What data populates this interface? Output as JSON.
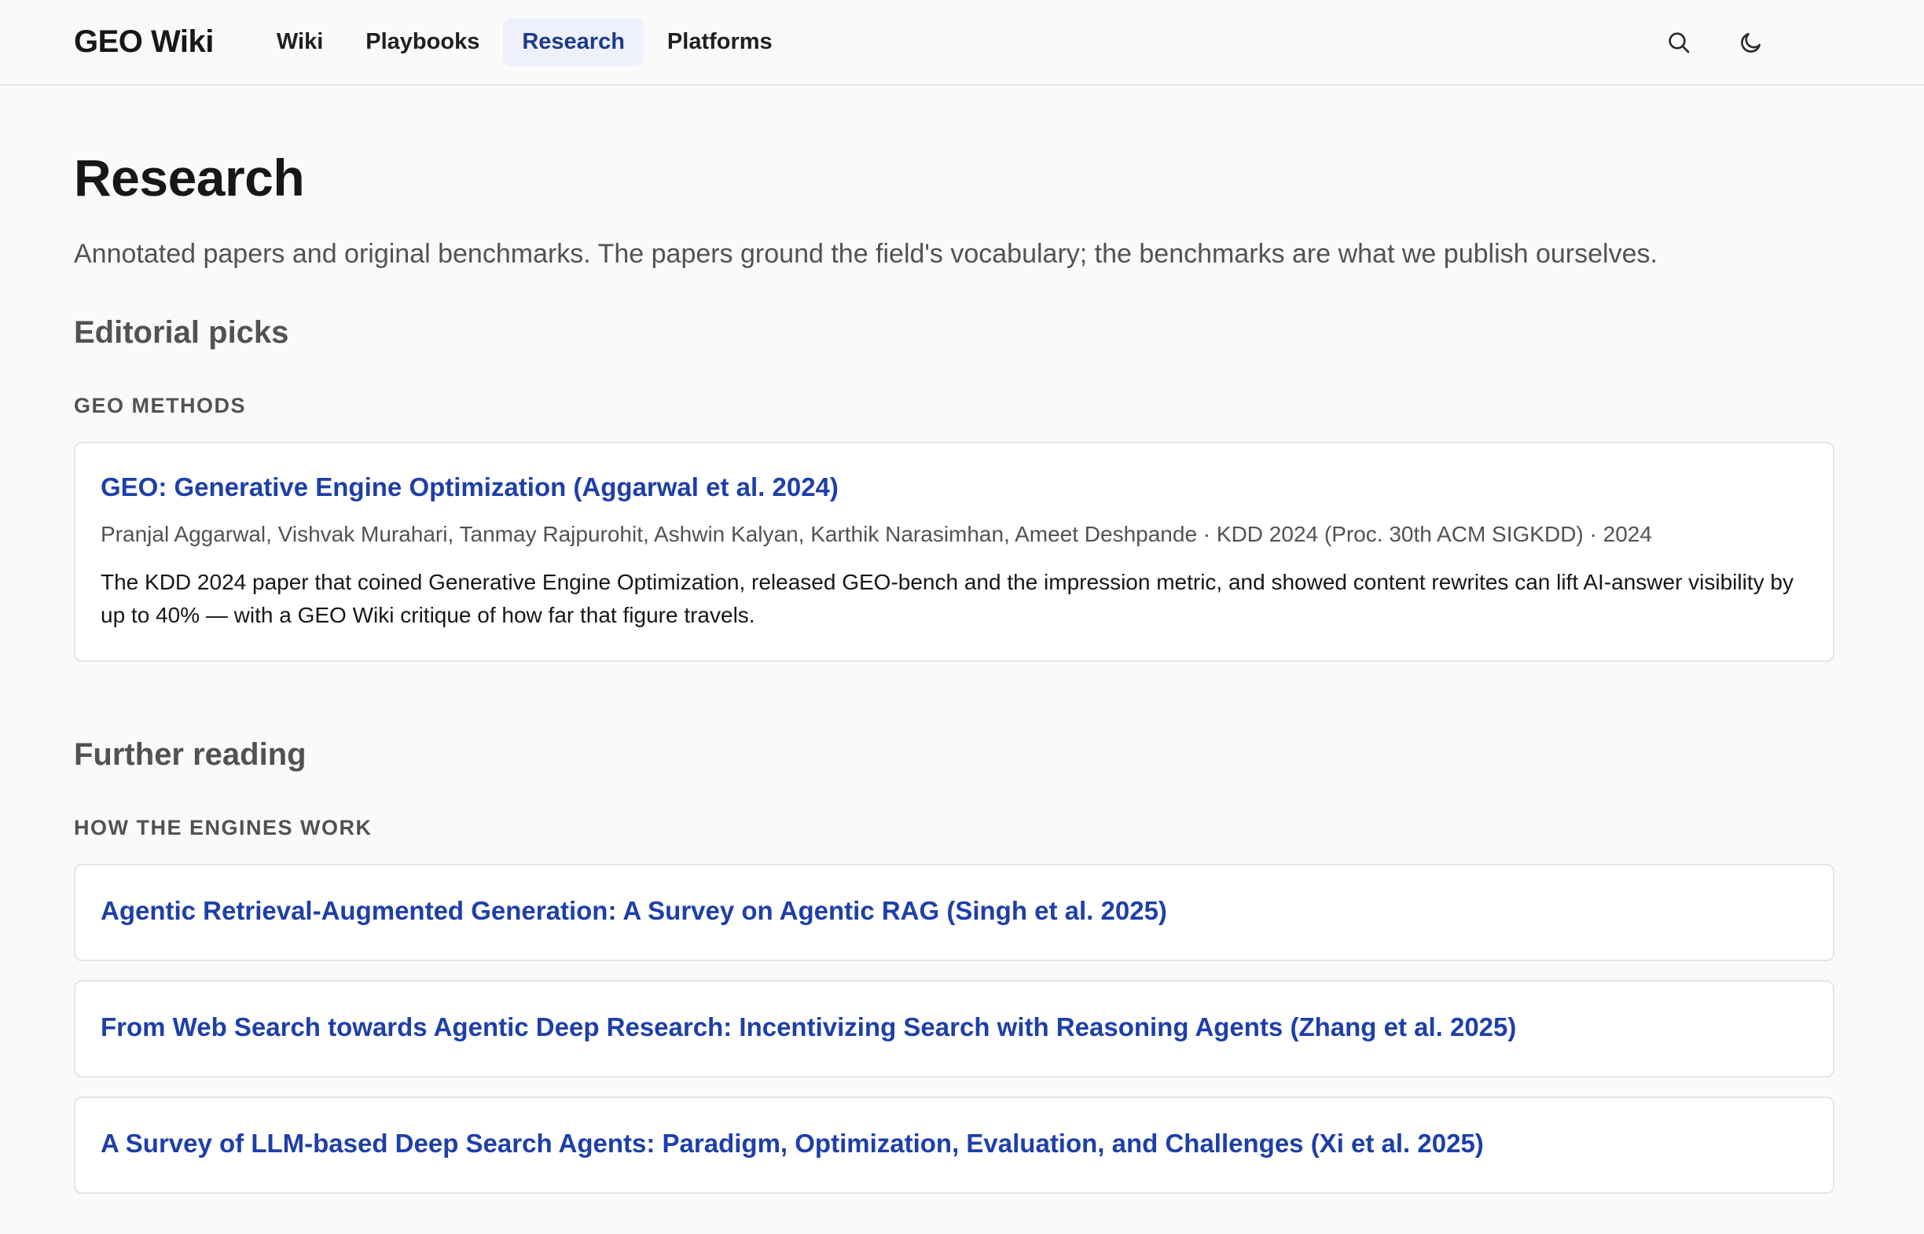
{
  "header": {
    "brand": "GEO Wiki",
    "nav": [
      {
        "label": "Wiki",
        "active": false
      },
      {
        "label": "Playbooks",
        "active": false
      },
      {
        "label": "Research",
        "active": true
      },
      {
        "label": "Platforms",
        "active": false
      }
    ],
    "icons": [
      "search-icon",
      "moon-icon"
    ]
  },
  "page": {
    "title": "Research",
    "lead": "Annotated papers and original benchmarks. The papers ground the field's vocabulary; the benchmarks are what we publish ourselves."
  },
  "editorial": {
    "heading": "Editorial picks",
    "group_label": "GEO METHODS",
    "card": {
      "title": "GEO: Generative Engine Optimization (Aggarwal et al. 2024)",
      "meta": "Pranjal Aggarwal, Vishvak Murahari, Tanmay Rajpurohit, Ashwin Kalyan, Karthik Narasimhan, Ameet Deshpande · KDD 2024 (Proc. 30th ACM SIGKDD) · 2024",
      "description": "The KDD 2024 paper that coined Generative Engine Optimization, released GEO-bench and the impression metric, and showed content rewrites can lift AI-answer visibility by up to 40% — with a GEO Wiki critique of how far that figure travels."
    }
  },
  "further": {
    "heading": "Further reading",
    "group_label": "HOW THE ENGINES WORK",
    "cards": [
      {
        "title": "Agentic Retrieval-Augmented Generation: A Survey on Agentic RAG (Singh et al. 2025)"
      },
      {
        "title": "From Web Search towards Agentic Deep Research: Incentivizing Search with Reasoning Agents (Zhang et al. 2025)"
      },
      {
        "title": "A Survey of LLM-based Deep Search Agents: Paradigm, Optimization, Evaluation, and Challenges (Xi et al. 2025)"
      }
    ]
  },
  "colors": {
    "link": "#1e3fa8",
    "active_nav_bg": "#eef1fb",
    "muted": "#525252",
    "border": "#e5e5e5"
  }
}
